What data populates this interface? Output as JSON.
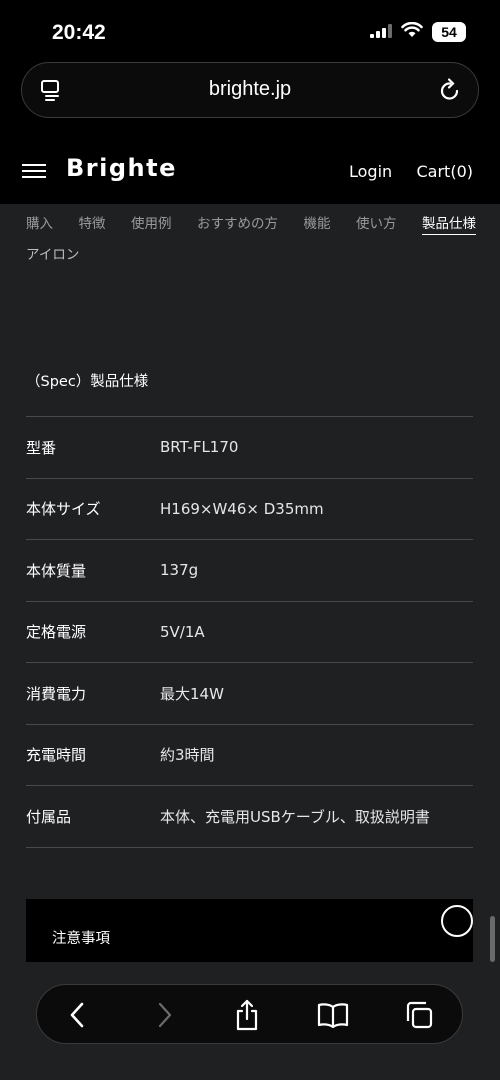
{
  "status_bar": {
    "time": "20:42",
    "battery": "54"
  },
  "browser": {
    "url": "brighte.jp"
  },
  "header": {
    "brand": "Brighte",
    "login": "Login",
    "cart": "Cart(0)"
  },
  "subnav": {
    "items": [
      "購入",
      "特徴",
      "使用例",
      "おすすめの方",
      "機能",
      "使い方",
      "製品仕様"
    ],
    "active": "製品仕様",
    "extra": "アイロン"
  },
  "spec": {
    "heading": "（Spec）製品仕様",
    "rows": [
      {
        "label": "型番",
        "value": "BRT-FL170"
      },
      {
        "label": "本体サイズ",
        "value": "H169×W46× D35mm"
      },
      {
        "label": "本体質量",
        "value": "137g"
      },
      {
        "label": "定格電源",
        "value": "5V/1A"
      },
      {
        "label": "消費電力",
        "value": "最大14W"
      },
      {
        "label": "充電時間",
        "value": "約3時間"
      },
      {
        "label": "付属品",
        "value": "本体、充電用USBケーブル、取扱説明書"
      }
    ]
  },
  "notes": {
    "title": "注意事項"
  },
  "icons": {
    "tab": "tab-overview-icon",
    "reload": "reload-icon",
    "menu": "hamburger-menu-icon",
    "back": "back-arrow-icon",
    "forward": "forward-arrow-icon",
    "share": "share-icon",
    "bookmarks": "bookmarks-icon",
    "tabs": "tabs-icon"
  }
}
